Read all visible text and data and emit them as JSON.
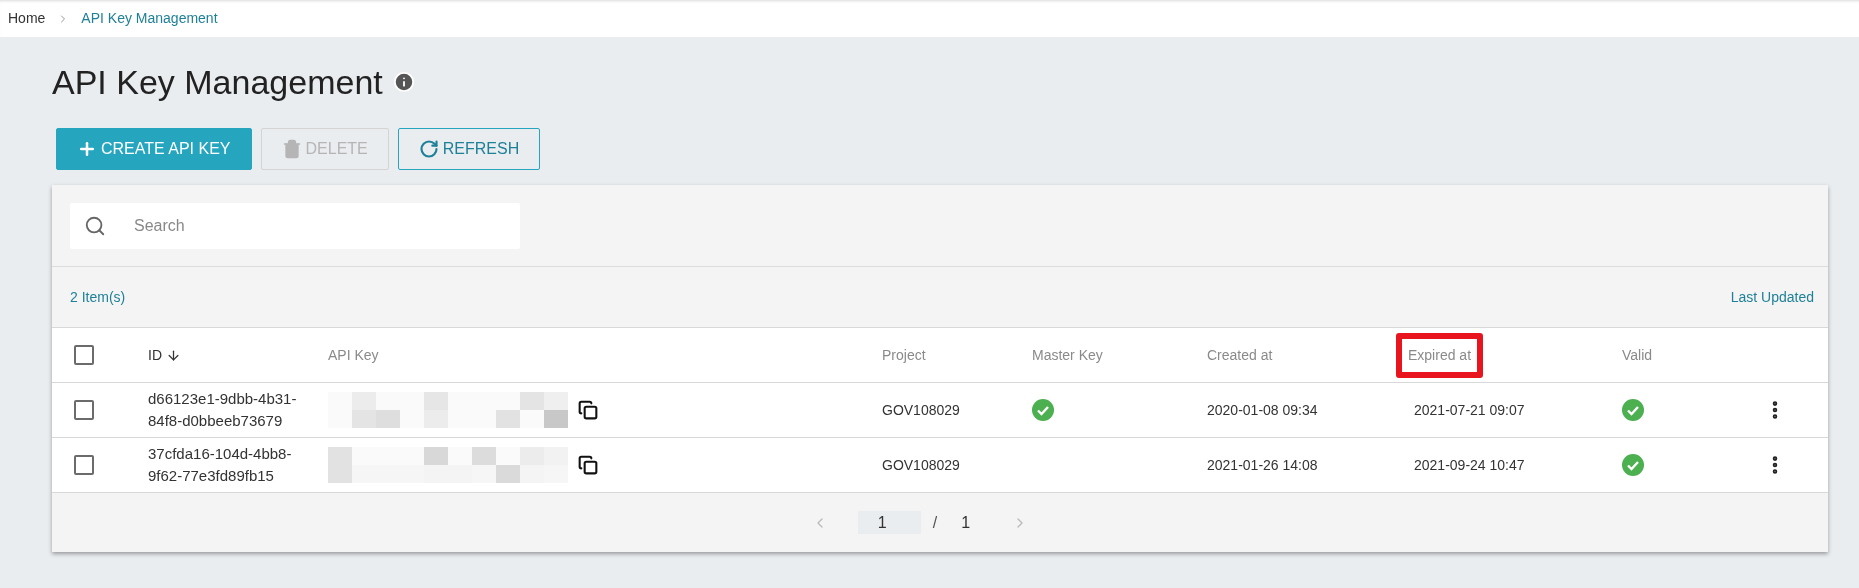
{
  "breadcrumb": [
    {
      "label": "Home",
      "current": false
    },
    {
      "label": "API Key Management",
      "current": true
    }
  ],
  "title": "API Key Management",
  "toolbar": [
    {
      "kind": "create",
      "label": "CREATE API KEY",
      "disabled": false
    },
    {
      "kind": "delete",
      "label": "DELETE",
      "disabled": true
    },
    {
      "kind": "refresh",
      "label": "REFRESH",
      "disabled": false
    }
  ],
  "search": {
    "placeholder": "Search"
  },
  "item_count": "2 Item(s)",
  "last_updated": "Last Updated",
  "table": {
    "select_all": {
      "checked": false
    },
    "columns": [
      {
        "label": "ID",
        "sorted": true,
        "highlighted": false
      },
      {
        "label": "API Key",
        "sorted": false,
        "highlighted": false
      },
      {
        "label": "Project",
        "sorted": false,
        "highlighted": false
      },
      {
        "label": "Master Key",
        "sorted": false,
        "highlighted": false
      },
      {
        "label": "Created at",
        "sorted": false,
        "highlighted": false
      },
      {
        "label": "Expired at",
        "sorted": false,
        "highlighted": true
      },
      {
        "label": "Valid",
        "sorted": false,
        "highlighted": false
      }
    ],
    "rows": [
      {
        "checked": false,
        "id": "d66123e1-9dbb-4b31-84f8-d0bbeeb73679",
        "project": "GOV108029",
        "master_key": true,
        "created": "2020-01-08 09:34",
        "expired": "2021-07-21 09:07",
        "valid": true
      },
      {
        "checked": false,
        "id": "37cfda16-104d-4bb8-9f62-77e3fd89fb15",
        "project": "GOV108029",
        "master_key": false,
        "created": "2021-01-26 14:08",
        "expired": "2021-09-24 10:47",
        "valid": true
      }
    ]
  },
  "pagination": {
    "page": "1",
    "separator": "/",
    "total": "1"
  }
}
